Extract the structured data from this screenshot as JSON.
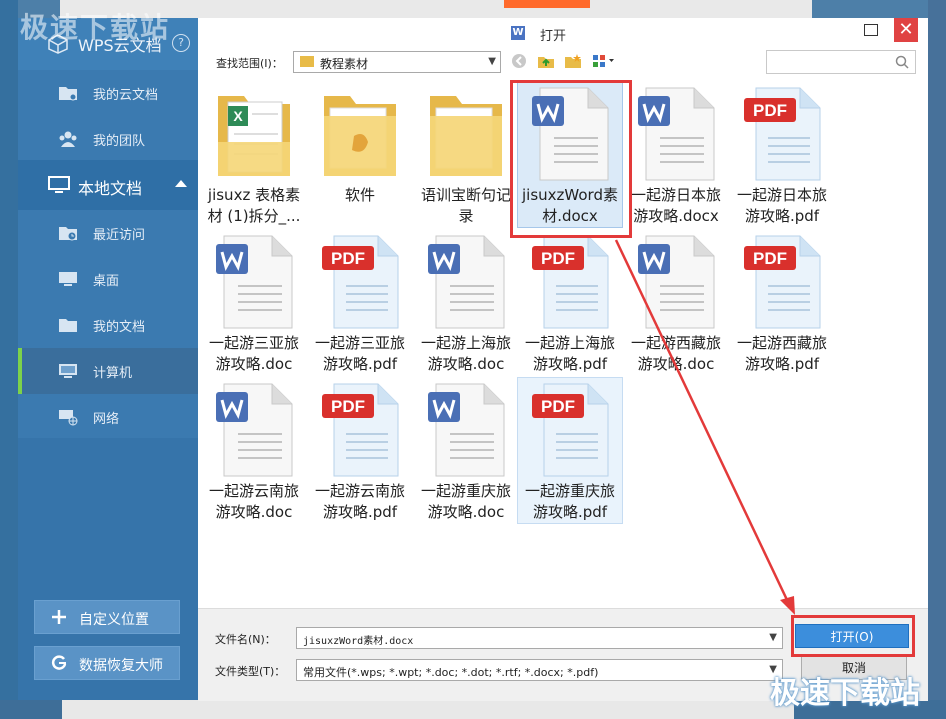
{
  "watermark": "极速下载站",
  "sidebar": {
    "brand": "WPS云文档",
    "help": "?",
    "items_top": [
      {
        "label": "我的云文档"
      },
      {
        "label": "我的团队"
      }
    ],
    "section": "本地文档",
    "items": [
      {
        "label": "最近访问"
      },
      {
        "label": "桌面"
      },
      {
        "label": "我的文档"
      },
      {
        "label": "计算机"
      },
      {
        "label": "网络"
      }
    ],
    "buttons": [
      {
        "label": "自定义位置"
      },
      {
        "label": "数据恢复大师"
      }
    ]
  },
  "dialog": {
    "title": "打开",
    "title_icon": "W",
    "close": "✕",
    "lookin_label": "查找范围(I)：",
    "lookin_value": "教程素材",
    "files": [
      {
        "name": "jisuxz 表格素材 (1)拆分_...",
        "type": "excel"
      },
      {
        "name": "软件",
        "type": "folder-sw"
      },
      {
        "name": "语训宝断句记录",
        "type": "folder"
      },
      {
        "name": "jisuxzWord素材.docx",
        "type": "word"
      },
      {
        "name": "一起游日本旅游攻略.docx",
        "type": "word"
      },
      {
        "name": "一起游日本旅游攻略.pdf",
        "type": "pdf"
      },
      {
        "name": "一起游三亚旅游攻略.doc",
        "type": "word"
      },
      {
        "name": "一起游三亚旅游攻略.pdf",
        "type": "pdf"
      },
      {
        "name": "一起游上海旅游攻略.doc",
        "type": "word"
      },
      {
        "name": "一起游上海旅游攻略.pdf",
        "type": "pdf"
      },
      {
        "name": "一起游西藏旅游攻略.doc",
        "type": "word"
      },
      {
        "name": "一起游西藏旅游攻略.pdf",
        "type": "pdf"
      },
      {
        "name": "一起游云南旅游攻略.doc",
        "type": "word"
      },
      {
        "name": "一起游云南旅游攻略.pdf",
        "type": "pdf"
      },
      {
        "name": "一起游重庆旅游攻略.doc",
        "type": "word"
      },
      {
        "name": "一起游重庆旅游攻略.pdf",
        "type": "pdf"
      }
    ],
    "filename_label": "文件名(N)：",
    "filename_value": "jisuxzWord素材.docx",
    "filetype_label": "文件类型(T)：",
    "filetype_value": "常用文件(*.wps; *.wpt; *.doc; *.dot; *.rtf; *.docx; *.pdf)",
    "open_button": "打开(O)",
    "cancel_button": "取消"
  },
  "colors": {
    "sidebar": "#3b7ab0",
    "accent_green": "#7dd24a",
    "highlight_red": "#e33a3a",
    "open_blue": "#3c8edc",
    "pdf_red": "#d9302c",
    "word_blue": "#4a6fb5"
  }
}
